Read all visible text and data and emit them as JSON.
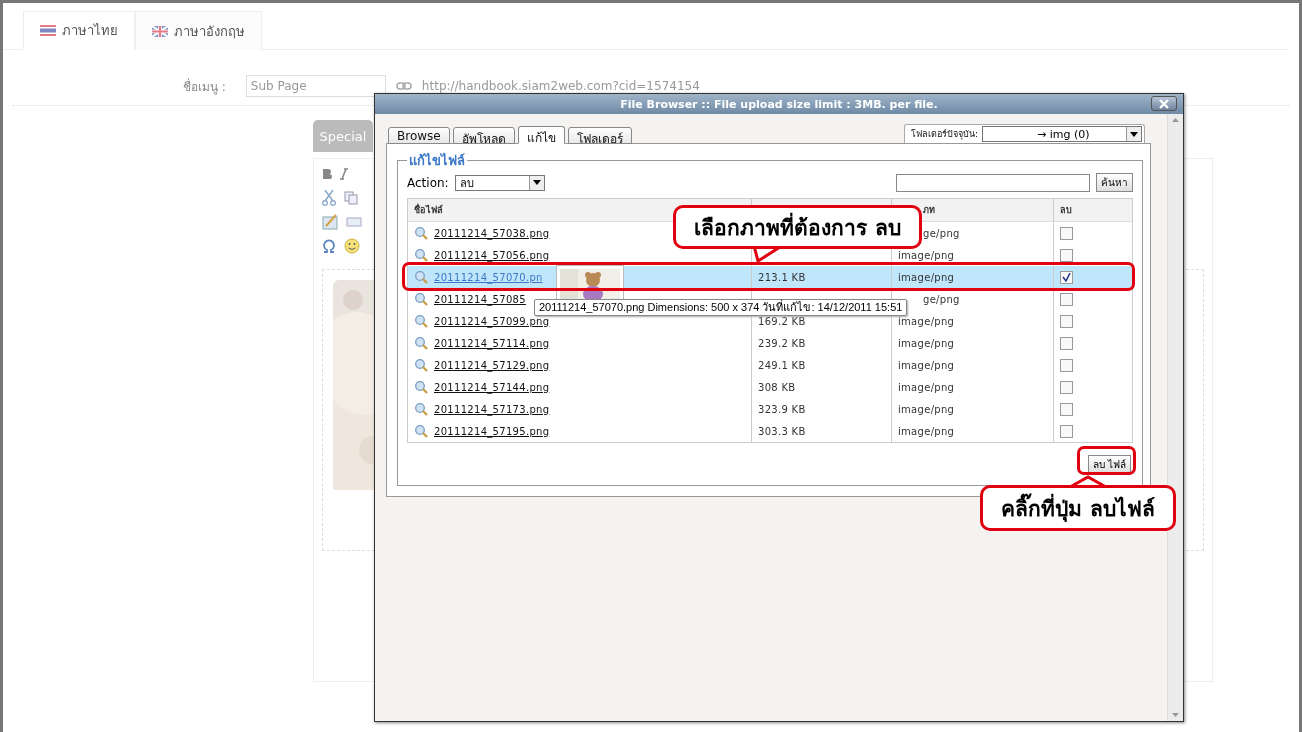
{
  "language_tabs": [
    {
      "label": "ภาษาไทย",
      "kind": "th",
      "selected": true
    },
    {
      "label": "ภาษาอังกฤษ",
      "kind": "uk",
      "selected": false
    }
  ],
  "menu_name": {
    "label": "ชื่อเมนู :",
    "value": "Sub Page",
    "url": "http://handbook.siam2web.com?cid=1574154"
  },
  "special_button": "Special",
  "dialog": {
    "title": "File Browser :: File upload size limit : 3MB. per file.",
    "tabs": [
      {
        "label": "Browse",
        "selected": false
      },
      {
        "label": "อัพโหลด",
        "selected": false
      },
      {
        "label": "แก้ไข",
        "selected": true
      },
      {
        "label": "โฟลเดอร์",
        "selected": false
      }
    ],
    "folder_label": "โฟลเดอร์ปัจจุบัน:",
    "folder_value": "→ img (0)",
    "legend": "แก้ไขไฟล์",
    "action_label": "Action:",
    "action_value": "ลบ",
    "search_button": "ค้นหา",
    "columns": {
      "column_1": "ชื่อไฟล์",
      "column_3": "ภท",
      "column_4": "ลบ"
    },
    "rows": [
      {
        "file": "20111214_57038.png",
        "type": "ge/png",
        "partial": true,
        "checked": false,
        "selected": false
      },
      {
        "file": "20111214_57056.png",
        "type": "image/png",
        "checked": false,
        "selected": false
      },
      {
        "file": "20111214_57070.pn",
        "size": "213.1 KB",
        "type": "image/png",
        "checked": true,
        "selected": true
      },
      {
        "file": "20111214_57085",
        "type": "ge/png",
        "partial": true,
        "checked": false,
        "selected": false
      },
      {
        "file": "20111214_57099.png",
        "size": "169.2 KB",
        "type": "image/png",
        "checked": false,
        "selected": false
      },
      {
        "file": "20111214_57114.png",
        "size": "239.2 KB",
        "type": "image/png",
        "checked": false,
        "selected": false
      },
      {
        "file": "20111214_57129.png",
        "size": "249.1 KB",
        "type": "image/png",
        "checked": false,
        "selected": false
      },
      {
        "file": "20111214_57144.png",
        "size": "308 KB",
        "type": "image/png",
        "checked": false,
        "selected": false
      },
      {
        "file": "20111214_57173.png",
        "size": "323.9 KB",
        "type": "image/png",
        "checked": false,
        "selected": false
      },
      {
        "file": "20111214_57195.png",
        "size": "303.3 KB",
        "type": "image/png",
        "checked": false,
        "selected": false
      }
    ],
    "delete_button": "ลบ ไฟล์",
    "tooltip": "20111214_57070.png Dimensions: 500 x 374 วันที่แก้ไข: 14/12/2011 15:51"
  },
  "callouts": [
    {
      "text": "เลือกภาพที่ต้องการ ลบ"
    },
    {
      "text": "คลิ๊กที่ปุ่ม ลบไฟล์"
    }
  ]
}
